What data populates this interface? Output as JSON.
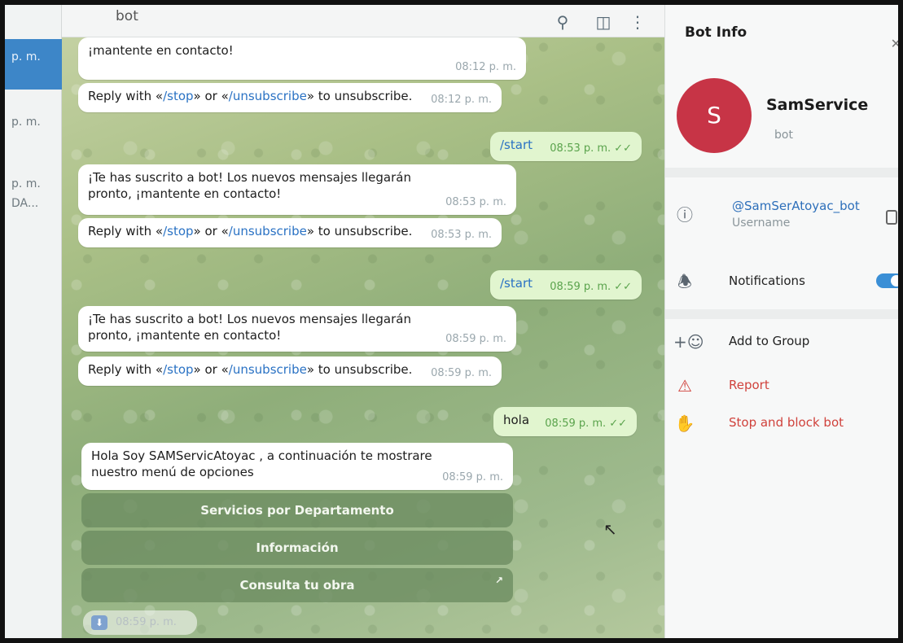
{
  "chatlist": {
    "times": [
      "p. m.",
      "p. m.",
      "p. m.",
      "DA..."
    ]
  },
  "header": {
    "title": "bot"
  },
  "messages": [
    {
      "text": "¡mantente en contacto!",
      "time": "08:12 p. m."
    },
    {
      "pre": "Reply with «",
      "link1": "/stop",
      "mid": "» or «",
      "link2": "/unsubscribe",
      "post": "» to unsubscribe.",
      "time": "08:12 p. m."
    },
    {
      "text": "/start",
      "time": "08:53 p. m.",
      "check": "✓✓"
    },
    {
      "text": "¡Te has suscrito a bot! Los nuevos mensajes llegarán pronto, ¡mantente en contacto!",
      "time": "08:53 p. m."
    },
    {
      "pre": "Reply with «",
      "link1": "/stop",
      "mid": "» or «",
      "link2": "/unsubscribe",
      "post": "» to unsubscribe.",
      "time": "08:53 p. m."
    },
    {
      "text": "/start",
      "time": "08:59 p. m.",
      "check": "✓✓"
    },
    {
      "text": "¡Te has suscrito a bot! Los nuevos mensajes llegarán pronto, ¡mantente en contacto!",
      "time": "08:59 p. m."
    },
    {
      "pre": "Reply with «",
      "link1": "/stop",
      "mid": "» or «",
      "link2": "/unsubscribe",
      "post": "» to unsubscribe.",
      "time": "08:59 p. m."
    },
    {
      "text": "hola",
      "time": "08:59 p. m.",
      "check": "✓✓"
    },
    {
      "text": "Hola Soy SAMServicAtoyac , a continuación te mostrare nuestro menú de opciones",
      "time": "08:59 p. m."
    }
  ],
  "keyboard": [
    "Servicios por Departamento",
    "Información",
    "Consulta tu obra"
  ],
  "scroll_time": "08:59 p. m.",
  "info": {
    "header": "Bot Info",
    "avatar_letter": "S",
    "name": "SamService",
    "sub": "bot",
    "username": "@SamSerAtoyac_bot",
    "username_label": "Username",
    "notifications": "Notifications",
    "notifications_on": true,
    "add_to_group": "Add to Group",
    "report": "Report",
    "stop_block": "Stop and block bot"
  },
  "colors": {
    "accent": "#3d86c8",
    "avatar": "#c73446",
    "danger": "#d0423c"
  }
}
